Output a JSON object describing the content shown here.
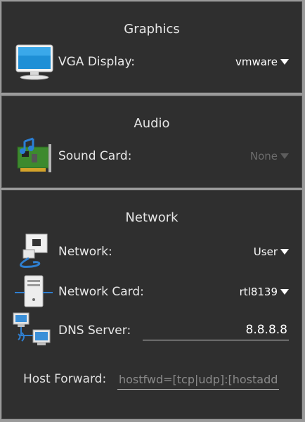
{
  "graphics": {
    "title": "Graphics",
    "vga_label": "VGA Display:",
    "vga_value": "vmware"
  },
  "audio": {
    "title": "Audio",
    "sound_label": "Sound Card:",
    "sound_value": "None"
  },
  "network": {
    "title": "Network",
    "network_label": "Network:",
    "network_value": "User",
    "card_label": "Network Card:",
    "card_value": "rtl8139",
    "dns_label": "DNS Server:",
    "dns_value": "8.8.8.8",
    "hostfwd_label": "Host Forward:",
    "hostfwd_placeholder": "hostfwd=[tcp|udp]:[hostaddr]:hostport-[guestaddr]:guestport"
  },
  "icons": {
    "vga": "monitor-icon",
    "sound": "sound-card-icon",
    "network": "network-jack-icon",
    "card": "computer-tower-icon",
    "dns": "network-computers-icon"
  }
}
